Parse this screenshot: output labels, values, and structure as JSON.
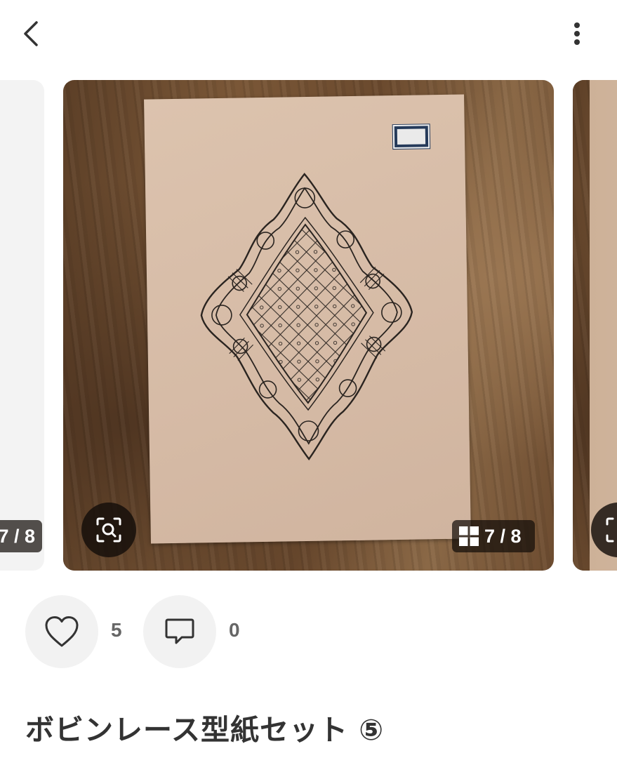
{
  "header": {
    "back_icon": "chevron-left-icon",
    "more_icon": "vertical-ellipsis-icon"
  },
  "carousel": {
    "current_index": 7,
    "total": 8,
    "counter_text": "7 / 8",
    "prev_counter_text": "7 / 8",
    "image_description_icon": "lace-pattern-photo",
    "zoom_icon": "image-search-icon",
    "grid_icon": "grid-icon"
  },
  "actions": {
    "like_icon": "heart-outline-icon",
    "like_count": "5",
    "comment_icon": "speech-bubble-icon",
    "comment_count": "0"
  },
  "post": {
    "title": "ボビンレース型紙セット ⑤"
  },
  "colors": {
    "icon_dark": "#333333",
    "button_bg": "#f2f2f2",
    "overlay_bg": "#140e0a",
    "count_gray": "#666666"
  }
}
